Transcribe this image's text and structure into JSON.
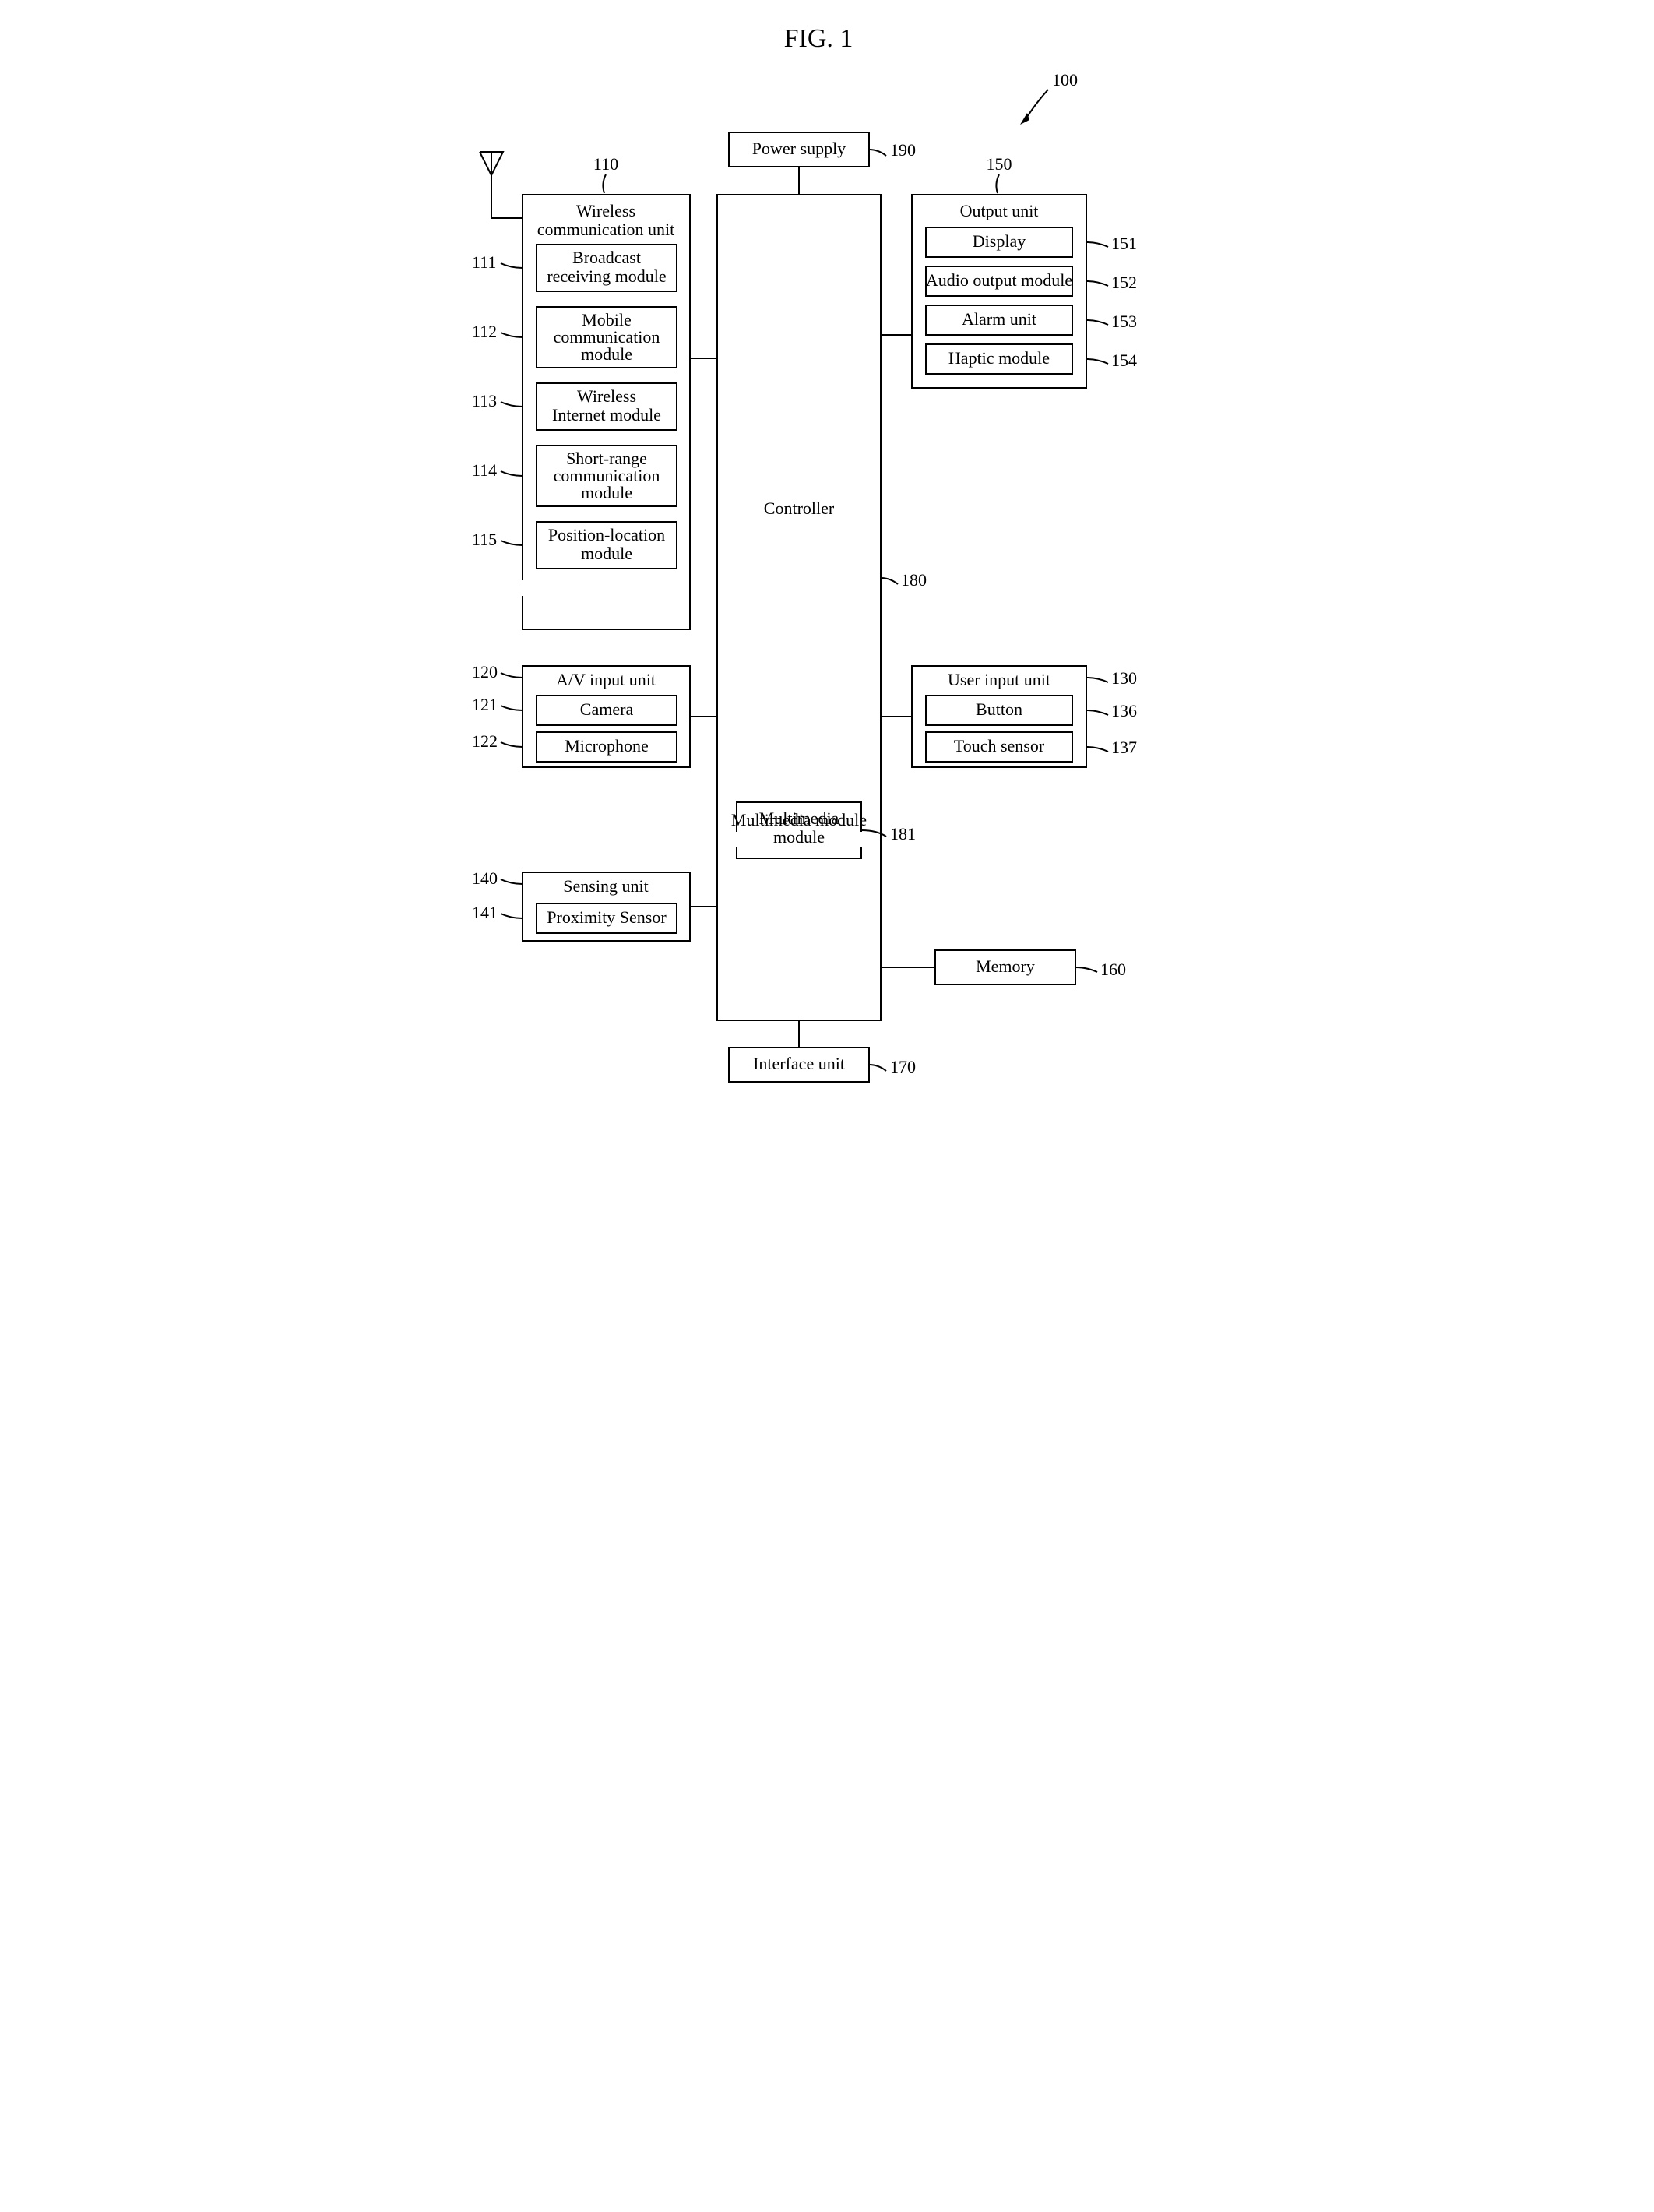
{
  "figure_title": "FIG. 1",
  "ref": {
    "r100": "100",
    "r110": "110",
    "r150": "150",
    "r190": "190",
    "r111": "111",
    "r112": "112",
    "r113": "113",
    "r114": "114",
    "r115": "115",
    "r120": "120",
    "r121": "121",
    "r122": "122",
    "r140": "140",
    "r141": "141",
    "r130": "130",
    "r136": "136",
    "r137": "137",
    "r151": "151",
    "r152": "152",
    "r153": "153",
    "r154": "154",
    "r160": "160",
    "r170": "170",
    "r180": "180",
    "r181": "181"
  },
  "labels": {
    "power_supply": "Power supply",
    "controller": "Controller",
    "wireless_unit": "Wireless communication unit",
    "broadcast": "Broadcast receiving module",
    "mobile_comm": "Mobile communication module",
    "wireless_internet": "Wireless Internet module",
    "short_range": "Short-range communication module",
    "position": "Position-location module",
    "av_input": "A/V input unit",
    "camera": "Camera",
    "microphone": "Microphone",
    "sensing_unit": "Sensing unit",
    "proximity": "Proximity Sensor",
    "output_unit": "Output unit",
    "display": "Display",
    "audio_out": "Audio output module",
    "alarm": "Alarm  unit",
    "haptic": "Haptic module",
    "user_input": "User input unit",
    "button": "Button",
    "touch_sensor": "Touch sensor",
    "multimedia": "Multimedia module",
    "memory": "Memory",
    "interface": "Interface unit"
  }
}
